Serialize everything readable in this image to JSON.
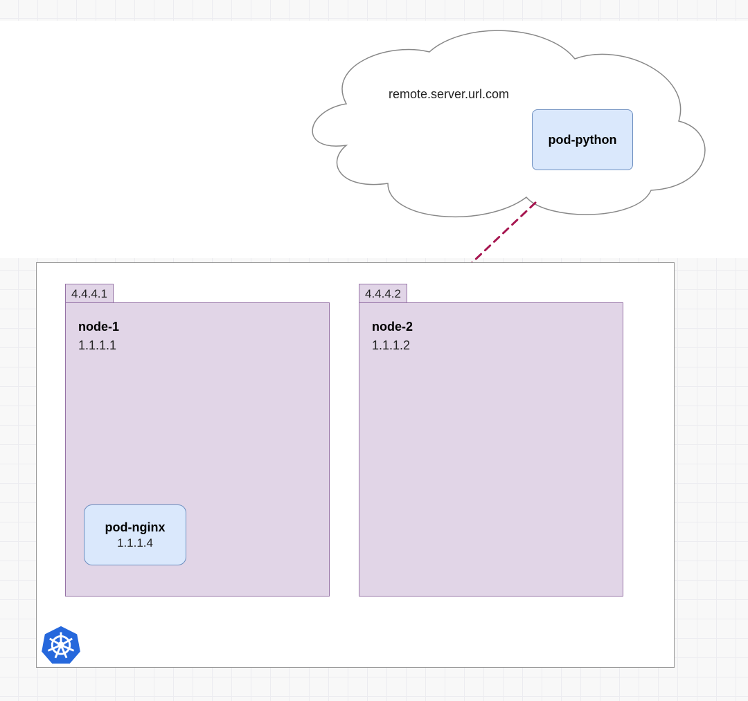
{
  "cloud": {
    "label": "remote.server.url.com",
    "pod": {
      "name": "pod-python"
    }
  },
  "cluster": {
    "nodes": [
      {
        "external_ip": "4.4.4.1",
        "name": "node-1",
        "internal_ip": "1.1.1.1",
        "pods": [
          {
            "name": "pod-nginx",
            "ip": "1.1.1.4"
          }
        ]
      },
      {
        "external_ip": "4.4.4.2",
        "name": "node-2",
        "internal_ip": "1.1.1.2",
        "pods": []
      }
    ]
  },
  "connection": {
    "from": "pod-nginx",
    "to": "cloud",
    "style": "dashed"
  }
}
